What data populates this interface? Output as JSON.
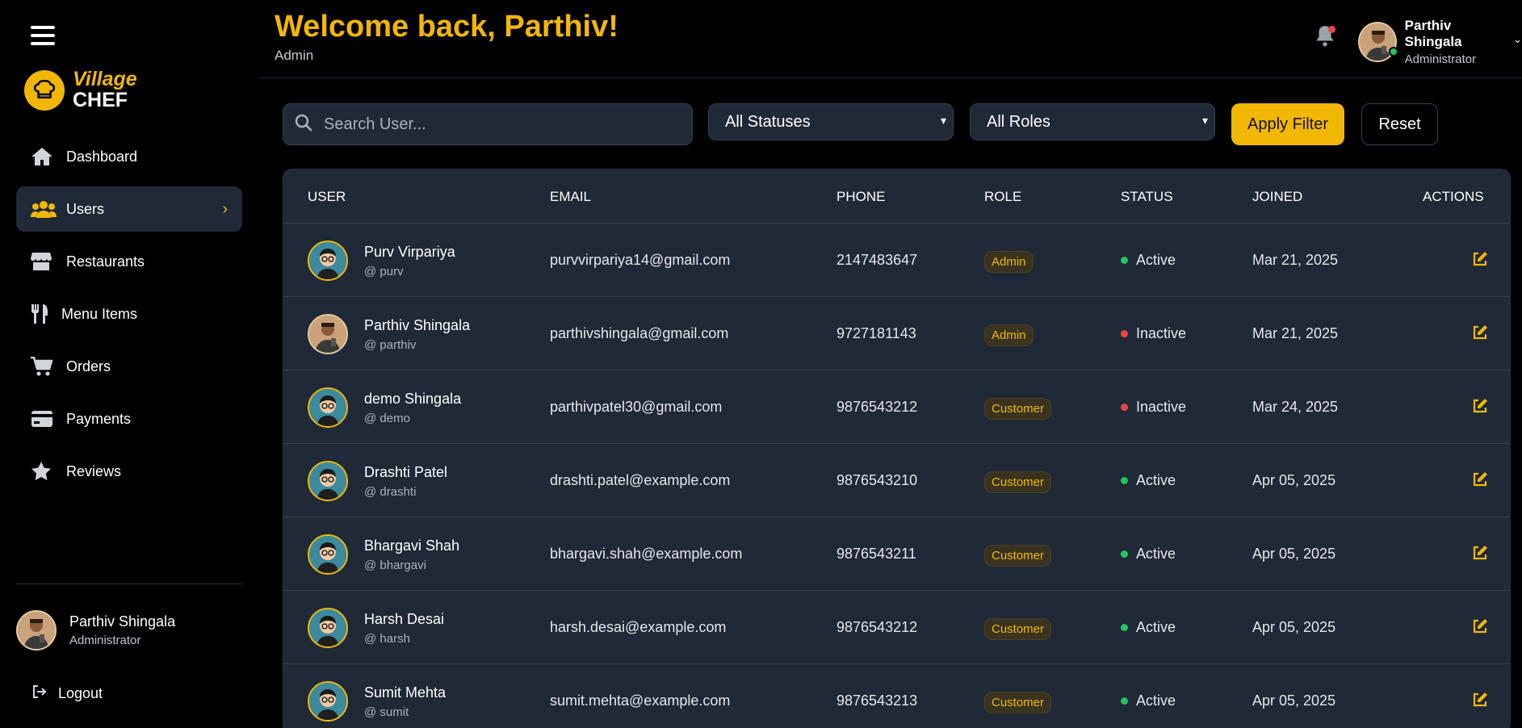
{
  "brand": {
    "line1": "Village",
    "line2": "CHEF"
  },
  "nav": [
    {
      "label": "Dashboard",
      "icon": "home-icon"
    },
    {
      "label": "Users",
      "icon": "users-icon"
    },
    {
      "label": "Restaurants",
      "icon": "store-icon"
    },
    {
      "label": "Menu Items",
      "icon": "utensils-icon"
    },
    {
      "label": "Orders",
      "icon": "cart-icon"
    },
    {
      "label": "Payments",
      "icon": "credit-card-icon"
    },
    {
      "label": "Reviews",
      "icon": "star-icon"
    }
  ],
  "sidebar_user": {
    "name": "Parthiv Shingala",
    "role": "Administrator"
  },
  "logout_label": "Logout",
  "header": {
    "welcome": "Welcome back, Parthiv!",
    "subtitle": "Admin",
    "user_name": "Parthiv Shingala",
    "user_role": "Administrator"
  },
  "filters": {
    "search_placeholder": "Search User...",
    "status_value": "All Statuses",
    "role_value": "All Roles",
    "apply_label": "Apply Filter",
    "reset_label": "Reset"
  },
  "table": {
    "headers": {
      "user": "USER",
      "email": "EMAIL",
      "phone": "PHONE",
      "role": "ROLE",
      "status": "STATUS",
      "joined": "JOINED",
      "actions": "ACTIONS"
    },
    "rows": [
      {
        "name": "Purv Virpariya",
        "handle": "@ purv",
        "email": "purvvirpariya14@gmail.com",
        "phone": "2147483647",
        "role": "Admin",
        "status": "Active",
        "joined": "Mar 21, 2025",
        "avatar": "cartoon-avatar"
      },
      {
        "name": "Parthiv Shingala",
        "handle": "@ parthiv",
        "email": "parthivshingala@gmail.com",
        "phone": "9727181143",
        "role": "Admin",
        "status": "Inactive",
        "joined": "Mar 21, 2025",
        "avatar": "photo-avatar"
      },
      {
        "name": "demo Shingala",
        "handle": "@ demo",
        "email": "parthivpatel30@gmail.com",
        "phone": "9876543212",
        "role": "Customer",
        "status": "Inactive",
        "joined": "Mar 24, 2025",
        "avatar": "cartoon-avatar"
      },
      {
        "name": "Drashti Patel",
        "handle": "@ drashti",
        "email": "drashti.patel@example.com",
        "phone": "9876543210",
        "role": "Customer",
        "status": "Active",
        "joined": "Apr 05, 2025",
        "avatar": "cartoon-avatar"
      },
      {
        "name": "Bhargavi Shah",
        "handle": "@ bhargavi",
        "email": "bhargavi.shah@example.com",
        "phone": "9876543211",
        "role": "Customer",
        "status": "Active",
        "joined": "Apr 05, 2025",
        "avatar": "cartoon-avatar"
      },
      {
        "name": "Harsh Desai",
        "handle": "@ harsh",
        "email": "harsh.desai@example.com",
        "phone": "9876543212",
        "role": "Customer",
        "status": "Active",
        "joined": "Apr 05, 2025",
        "avatar": "cartoon-avatar"
      },
      {
        "name": "Sumit Mehta",
        "handle": "@ sumit",
        "email": "sumit.mehta@example.com",
        "phone": "9876543213",
        "role": "Customer",
        "status": "Active",
        "joined": "Apr 05, 2025",
        "avatar": "cartoon-avatar"
      }
    ]
  },
  "colors": {
    "accent": "#f2b705",
    "active": "#22c55e",
    "inactive": "#ef4444",
    "panel": "#1f2937"
  }
}
